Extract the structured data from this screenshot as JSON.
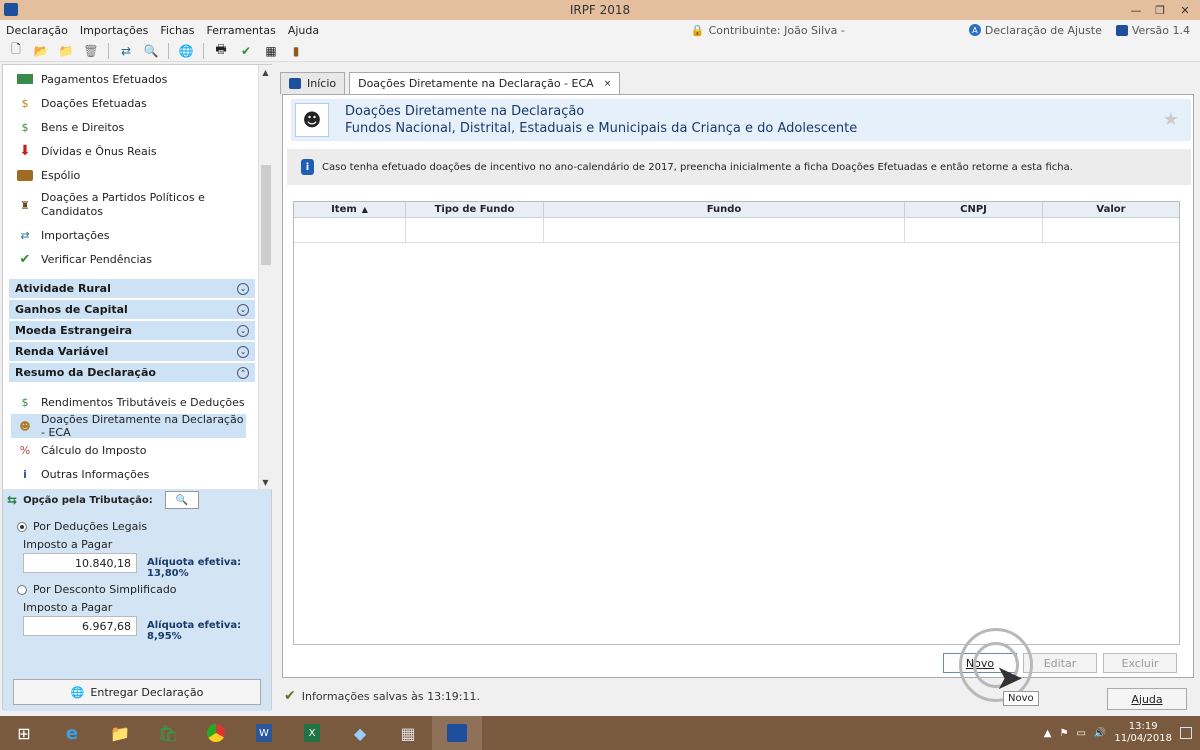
{
  "window": {
    "title": "IRPF 2018"
  },
  "menu": [
    "Declaração",
    "Importações",
    "Fichas",
    "Ferramentas",
    "Ajuda"
  ],
  "menu_right": {
    "taxpayer": "Contribuinte: João Silva -",
    "mode": "Declaração de Ajuste",
    "version": "Versão 1.4"
  },
  "nav": {
    "items_top": [
      "Pagamentos Efetuados",
      "Doações Efetuadas",
      "Bens e Direitos",
      "Dívidas e Ônus Reais",
      "Espólio",
      "Doações a Partidos Políticos e Candidatos",
      "Importações",
      "Verificar Pendências"
    ],
    "sections": [
      "Atividade Rural",
      "Ganhos de Capital",
      "Moeda Estrangeira",
      "Renda Variável",
      "Resumo da Declaração"
    ],
    "summary_items": [
      "Rendimentos Tributáveis e Deduções",
      "Doações Diretamente na Declaração - ECA",
      "Cálculo do Imposto",
      "Outras Informações"
    ]
  },
  "tax": {
    "header": "Opção pela Tributação:",
    "option1": "Por Deduções Legais",
    "label1": "Imposto a Pagar",
    "value1": "10.840,18",
    "rate1": "Alíquota efetiva: 13,80%",
    "option2": "Por Desconto Simplificado",
    "label2": "Imposto a Pagar",
    "value2": "6.967,68",
    "rate2": "Alíquota efetiva: 8,95%",
    "submit": "Entregar Declaração"
  },
  "tabs": [
    "Início",
    "Doações Diretamente na Declaração - ECA"
  ],
  "page": {
    "title": "Doações Diretamente na Declaração",
    "subtitle": "Fundos Nacional, Distrital, Estaduais e Municipais da Criança e do Adolescente",
    "info": "Caso tenha efetuado doações de incentivo no ano-calendário de 2017, preencha inicialmente a ficha Doações Efetuadas e então retorne a esta ficha."
  },
  "table": {
    "columns": [
      "Item",
      "Tipo de Fundo",
      "Fundo",
      "CNPJ",
      "Valor"
    ]
  },
  "buttons": {
    "new": "Novo",
    "edit": "Editar",
    "delete": "Excluir",
    "help": "Ajuda",
    "tooltip": "Novo"
  },
  "status": "Informações salvas às 13:19:11.",
  "taskbar": {
    "time": "13:19",
    "date": "11/04/2018"
  },
  "colors": {
    "titlebar": "#e4bf9d",
    "section": "#cde3f5",
    "taxpanel": "#d3e5f5",
    "taskbar": "#7a5a3e"
  }
}
